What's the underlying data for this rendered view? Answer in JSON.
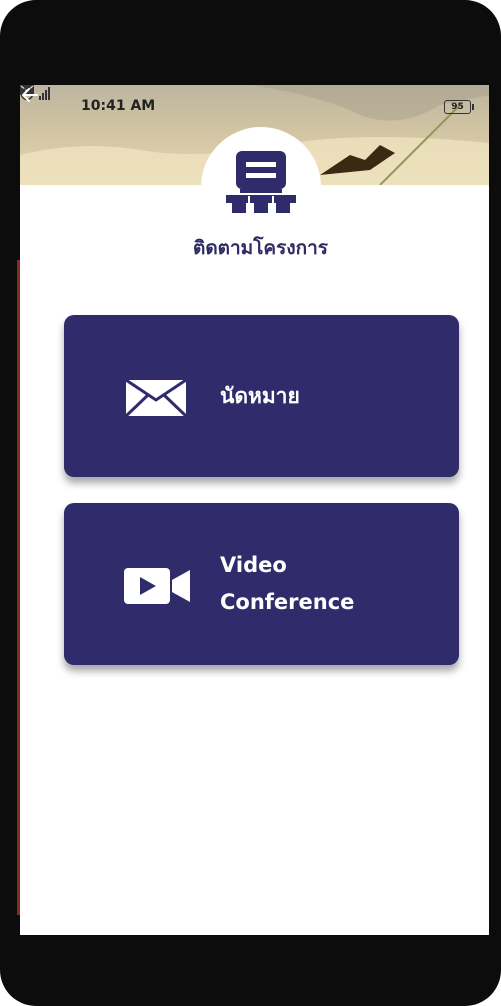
{
  "status_bar": {
    "time": "10:41 AM",
    "battery": "95",
    "network": "4G"
  },
  "header": {
    "back_icon": "arrow-left-icon",
    "logo_icon": "org-chart-icon",
    "title": "ติดตามโครงการ"
  },
  "menu": {
    "items": [
      {
        "label": "นัดหมาย",
        "icon": "envelope-icon"
      },
      {
        "label_line1": "Video",
        "label_line2": "Conference",
        "icon": "video-camera-icon"
      }
    ]
  },
  "colors": {
    "accent": "#302b6b",
    "title": "#2f2a63",
    "background": "#ffffff"
  }
}
